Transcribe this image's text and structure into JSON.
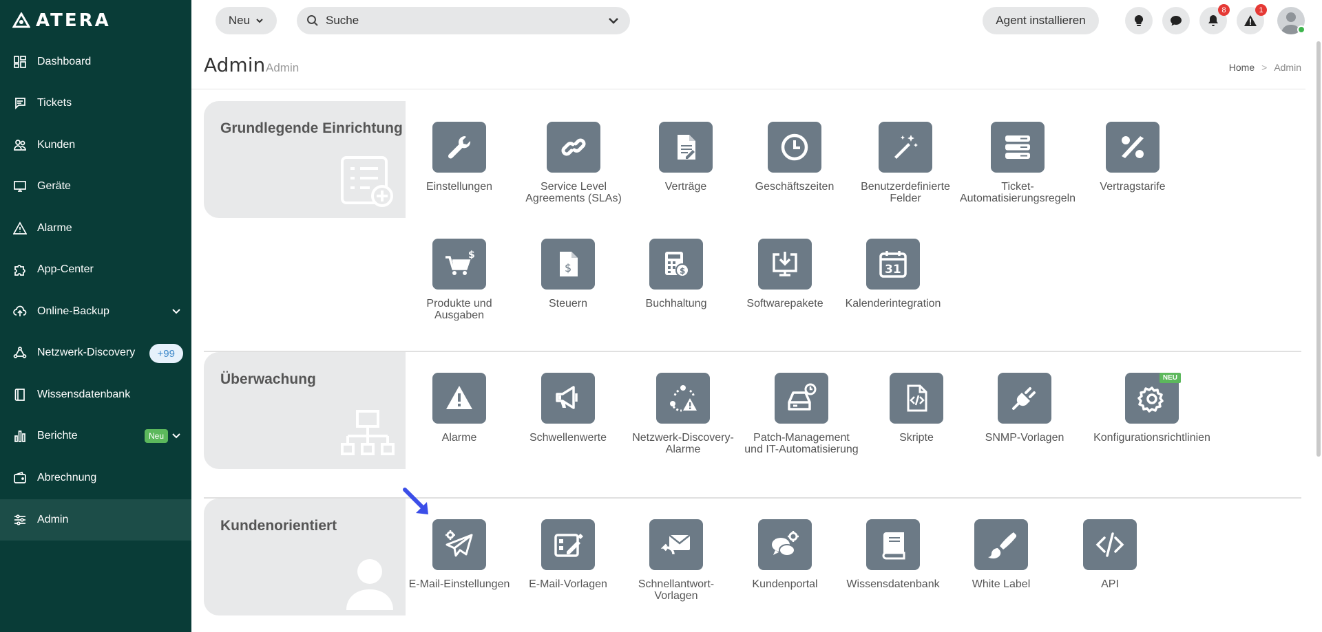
{
  "brand": {
    "name": "ATERA"
  },
  "sidebar": {
    "items": [
      {
        "label": "Dashboard"
      },
      {
        "label": "Tickets"
      },
      {
        "label": "Kunden"
      },
      {
        "label": "Geräte"
      },
      {
        "label": "Alarme"
      },
      {
        "label": "App-Center"
      },
      {
        "label": "Online-Backup"
      },
      {
        "label": "Netzwerk-Discovery",
        "badge": "+99"
      },
      {
        "label": "Wissensdatenbank"
      },
      {
        "label": "Berichte",
        "badge": "Neu"
      },
      {
        "label": "Abrechnung"
      },
      {
        "label": "Admin"
      }
    ]
  },
  "topbar": {
    "new_label": "Neu",
    "search_placeholder": "Suche",
    "agent_label": "Agent installieren",
    "notifications_count": "8",
    "alerts_count": "1"
  },
  "page": {
    "title": "Admin",
    "subtitle": "Admin",
    "breadcrumb": {
      "home": "Home",
      "separator": ">",
      "current": "Admin"
    }
  },
  "sections": {
    "basic": {
      "title": "Grundlegende Einrichtung",
      "tiles": [
        {
          "label": "Einstellungen",
          "icon": "wrench-icon"
        },
        {
          "label": "Service Level Agreements (SLAs)",
          "icon": "link-icon"
        },
        {
          "label": "Verträge",
          "icon": "contract-document-icon"
        },
        {
          "label": "Geschäftszeiten",
          "icon": "clock-icon"
        },
        {
          "label": "Benutzerdefinierte Felder",
          "icon": "magic-wand-icon"
        },
        {
          "label": "Ticket-Automatisierungsregeln",
          "icon": "server-list-icon"
        },
        {
          "label": "Vertragstarife",
          "icon": "percent-icon"
        },
        {
          "label": "Produkte und Ausgaben",
          "icon": "cart-dollar-icon"
        },
        {
          "label": "Steuern",
          "icon": "dollar-document-icon"
        },
        {
          "label": "Buchhaltung",
          "icon": "calculator-icon"
        },
        {
          "label": "Softwarepakete",
          "icon": "download-monitor-icon"
        },
        {
          "label": "Kalenderintegration",
          "icon": "calendar-icon",
          "icon_text": "31"
        }
      ]
    },
    "monitoring": {
      "title": "Überwachung",
      "tiles": [
        {
          "label": "Alarme",
          "icon": "warning-icon"
        },
        {
          "label": "Schwellenwerte",
          "icon": "megaphone-icon"
        },
        {
          "label": "Netzwerk-Discovery-Alarme",
          "icon": "network-alert-icon"
        },
        {
          "label": "Patch-Management und IT-Automatisierung",
          "icon": "drive-clock-icon"
        },
        {
          "label": "Skripte",
          "icon": "code-file-icon"
        },
        {
          "label": "SNMP-Vorlagen",
          "icon": "plug-icon"
        },
        {
          "label": "Konfigurationsrichtlinien",
          "icon": "gear-icon",
          "tag": "NEU"
        }
      ]
    },
    "customer": {
      "title": "Kundenorientiert",
      "tiles": [
        {
          "label": "E-Mail-Einstellungen",
          "icon": "paper-plane-gear-icon"
        },
        {
          "label": "E-Mail-Vorlagen",
          "icon": "template-edit-icon"
        },
        {
          "label": "Schnellantwort-Vorlagen",
          "icon": "mail-reply-icon"
        },
        {
          "label": "Kundenportal",
          "icon": "chat-gear-icon"
        },
        {
          "label": "Wissensdatenbank",
          "icon": "book-icon"
        },
        {
          "label": "White Label",
          "icon": "brush-icon"
        },
        {
          "label": "API",
          "icon": "code-icon"
        }
      ]
    }
  },
  "colors": {
    "sidebar_bg": "#093c37",
    "sidebar_active": "#1c4d48",
    "tile_bg": "#6c7a86",
    "section_bg": "#e8e9ea",
    "badge_green": "#5cb85c",
    "badge_red": "#e53935",
    "pointer_blue": "#3b4ee8"
  }
}
